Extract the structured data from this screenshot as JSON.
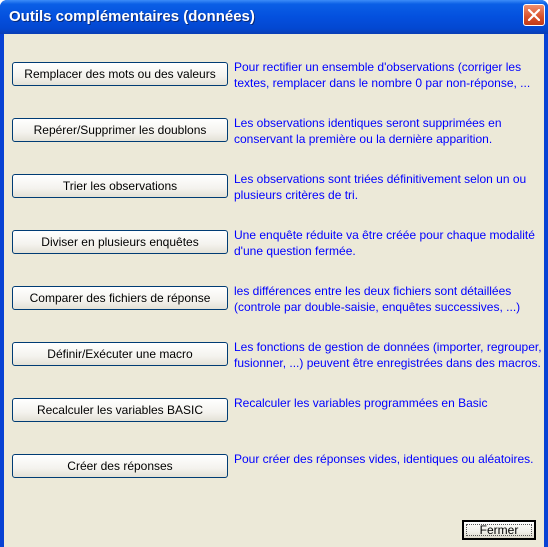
{
  "window": {
    "title": "Outils complémentaires (données)"
  },
  "actions": [
    {
      "label": "Remplacer des mots ou des valeurs",
      "description": "Pour rectifier un ensemble d'observations (corriger les textes, remplacer dans le nombre 0 par non-réponse, ..."
    },
    {
      "label": "Repérer/Supprimer les doublons",
      "description": "Les observations identiques seront supprimées en conservant la première ou la dernière apparition."
    },
    {
      "label": "Trier les observations",
      "description": "Les observations sont triées définitivement selon un ou plusieurs critères de tri."
    },
    {
      "label": "Diviser en plusieurs enquêtes",
      "description": "Une enquête réduite va être créée pour chaque modalité d'une question fermée."
    },
    {
      "label": "Comparer des fichiers de réponse",
      "description": "les différences entre les deux fichiers sont détaillées (controle par double-saisie, enquêtes successives, ...)"
    },
    {
      "label": "Définir/Exécuter une macro",
      "description": "Les fonctions de gestion de données (importer, regrouper, fusionner, ...) peuvent être enregistrées dans des macros."
    },
    {
      "label": "Recalculer les variables BASIC",
      "description": "Recalculer les variables programmées en Basic"
    },
    {
      "label": "Créer des réponses",
      "description": "Pour créer des réponses vides, identiques ou aléatoires."
    }
  ],
  "footer": {
    "close_label": "Fermer"
  },
  "colors": {
    "title_bar": "#0450de",
    "description_text": "#0000ff",
    "client_bg": "#ece9d8",
    "close_icon_bg": "#d8502a"
  },
  "icons": {
    "close": "close-icon"
  }
}
